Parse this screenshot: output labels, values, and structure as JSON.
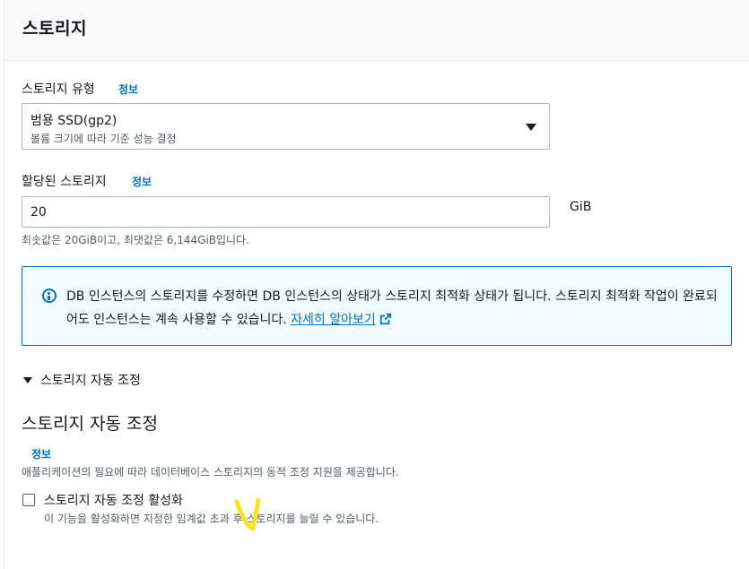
{
  "panel": {
    "title": "스토리지"
  },
  "storage_type": {
    "label": "스토리지 유형",
    "info": "정보",
    "selected_value": "범용 SSD(gp2)",
    "selected_desc": "볼륨 크기에 따라 기준 성능 결정"
  },
  "allocated_storage": {
    "label": "할당된 스토리지",
    "info": "정보",
    "value": "20",
    "unit": "GiB",
    "hint": "최솟값은 20GiB이고, 최댓값은 6,144GiB입니다."
  },
  "alert": {
    "text": "DB 인스턴스의 스토리지를 수정하면 DB 인스턴스의 상태가 스토리지 최적화 상태가 됩니다. 스토리지 최적화 작업이 완료되어도 인스턴스는 계속 사용할 수 있습니다. ",
    "link": "자세히 알아보기",
    "accent_color": "#0073bb"
  },
  "autoscaling": {
    "expand_label": "스토리지 자동 조정",
    "heading": "스토리지 자동 조정",
    "info": "정보",
    "description": "애플리케이션의 필요에 따라 데이터베이스 스토리지의 동적 조정 지원을 제공합니다.",
    "checkbox_label": "스토리지 자동 조정 활성화",
    "checkbox_checked": false,
    "checkbox_desc": "이 기능을 활성화하면 지정한 임계값 초과 후 스토리지를 늘릴 수 있습니다."
  },
  "annotation": {
    "color": "#f5e600"
  }
}
